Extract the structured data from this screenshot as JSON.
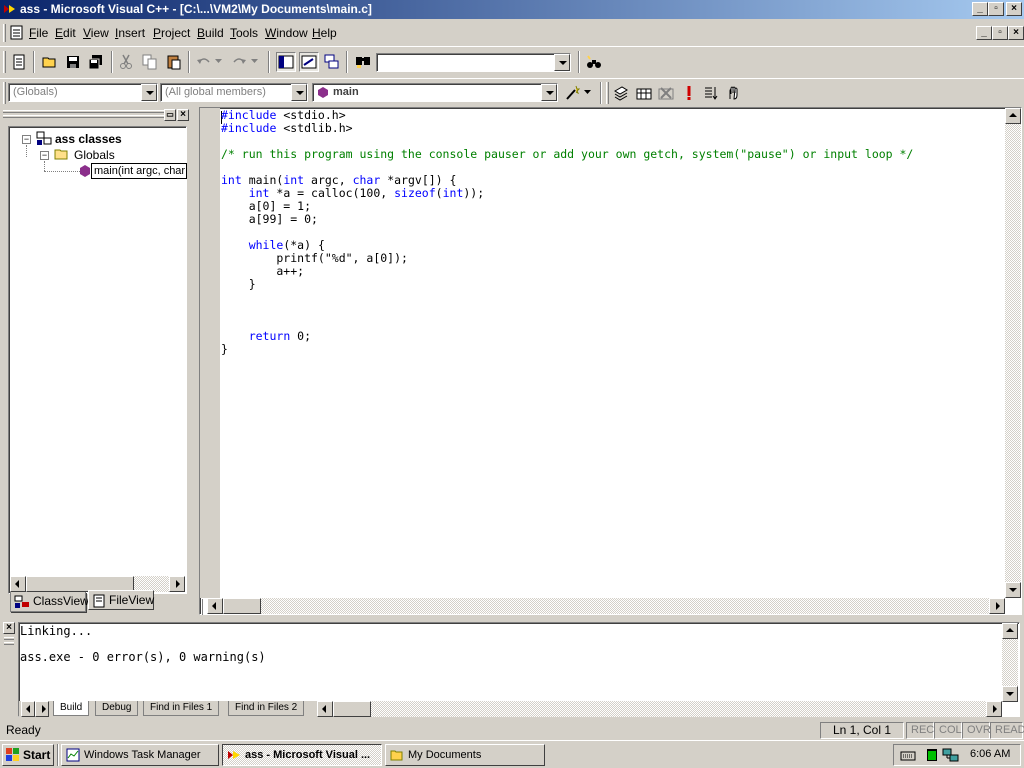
{
  "window": {
    "title": "ass - Microsoft Visual C++ - [C:\\...\\VM2\\My Documents\\main.c]"
  },
  "menu": [
    {
      "key": "F",
      "rest": "ile"
    },
    {
      "key": "E",
      "rest": "dit"
    },
    {
      "key": "V",
      "rest": "iew"
    },
    {
      "key": "I",
      "rest": "nsert"
    },
    {
      "key": "P",
      "rest": "roject"
    },
    {
      "key": "B",
      "rest": "uild"
    },
    {
      "key": "T",
      "rest": "ools"
    },
    {
      "key": "W",
      "rest": "indow"
    },
    {
      "key": "H",
      "rest": "elp"
    }
  ],
  "wizardbar": {
    "scope": "(Globals)",
    "members": "(All global members)",
    "function": "main"
  },
  "find_combo": "",
  "classview": {
    "root": "ass classes",
    "folder": "Globals",
    "item": "main(int argc, char"
  },
  "workspace_tabs": [
    "ClassView",
    "FileView"
  ],
  "editor": {
    "lines": [
      [
        {
          "t": "#include",
          "c": "kw"
        },
        {
          "t": " <stdio.h>"
        }
      ],
      [
        {
          "t": "#include",
          "c": "kw"
        },
        {
          "t": " <stdlib.h>"
        }
      ],
      [],
      [
        {
          "t": "/* run this program using the console pauser or add your own getch, system(\"pause\") or input loop */",
          "c": "cm"
        }
      ],
      [],
      [
        {
          "t": "int",
          "c": "kw"
        },
        {
          "t": " main("
        },
        {
          "t": "int",
          "c": "kw"
        },
        {
          "t": " argc, "
        },
        {
          "t": "char",
          "c": "kw"
        },
        {
          "t": " *argv[]) {"
        }
      ],
      [
        {
          "t": "    "
        },
        {
          "t": "int",
          "c": "kw"
        },
        {
          "t": " *a = calloc(100, "
        },
        {
          "t": "sizeof",
          "c": "kw"
        },
        {
          "t": "("
        },
        {
          "t": "int",
          "c": "kw"
        },
        {
          "t": "));"
        }
      ],
      [
        {
          "t": "    a[0] = 1;"
        }
      ],
      [
        {
          "t": "    a[99] = 0;"
        }
      ],
      [],
      [
        {
          "t": "    "
        },
        {
          "t": "while",
          "c": "kw"
        },
        {
          "t": "(*a) {"
        }
      ],
      [
        {
          "t": "        printf(\"%d\", a[0]);"
        }
      ],
      [
        {
          "t": "        a++;"
        }
      ],
      [
        {
          "t": "    }"
        }
      ],
      [],
      [],
      [],
      [
        {
          "t": "    "
        },
        {
          "t": "return",
          "c": "kw"
        },
        {
          "t": " 0;"
        }
      ],
      [
        {
          "t": "}"
        }
      ]
    ]
  },
  "output": {
    "lines": [
      "Linking...",
      "",
      "ass.exe - 0 error(s), 0 warning(s)"
    ],
    "tabs": [
      "Build",
      "Debug",
      "Find in Files 1",
      "Find in Files 2"
    ]
  },
  "status": {
    "message": "Ready",
    "position": "Ln 1, Col 1",
    "indicators": [
      "REC",
      "COL",
      "OVR",
      "READ"
    ]
  },
  "taskbar": {
    "start": "Start",
    "tasks": [
      "Windows Task Manager",
      "ass - Microsoft Visual ...",
      "My Documents"
    ],
    "clock": "6:06 AM"
  },
  "colors": {
    "keyword": "#0000ff",
    "comment": "#008000",
    "titlebar": "#0a246a"
  }
}
